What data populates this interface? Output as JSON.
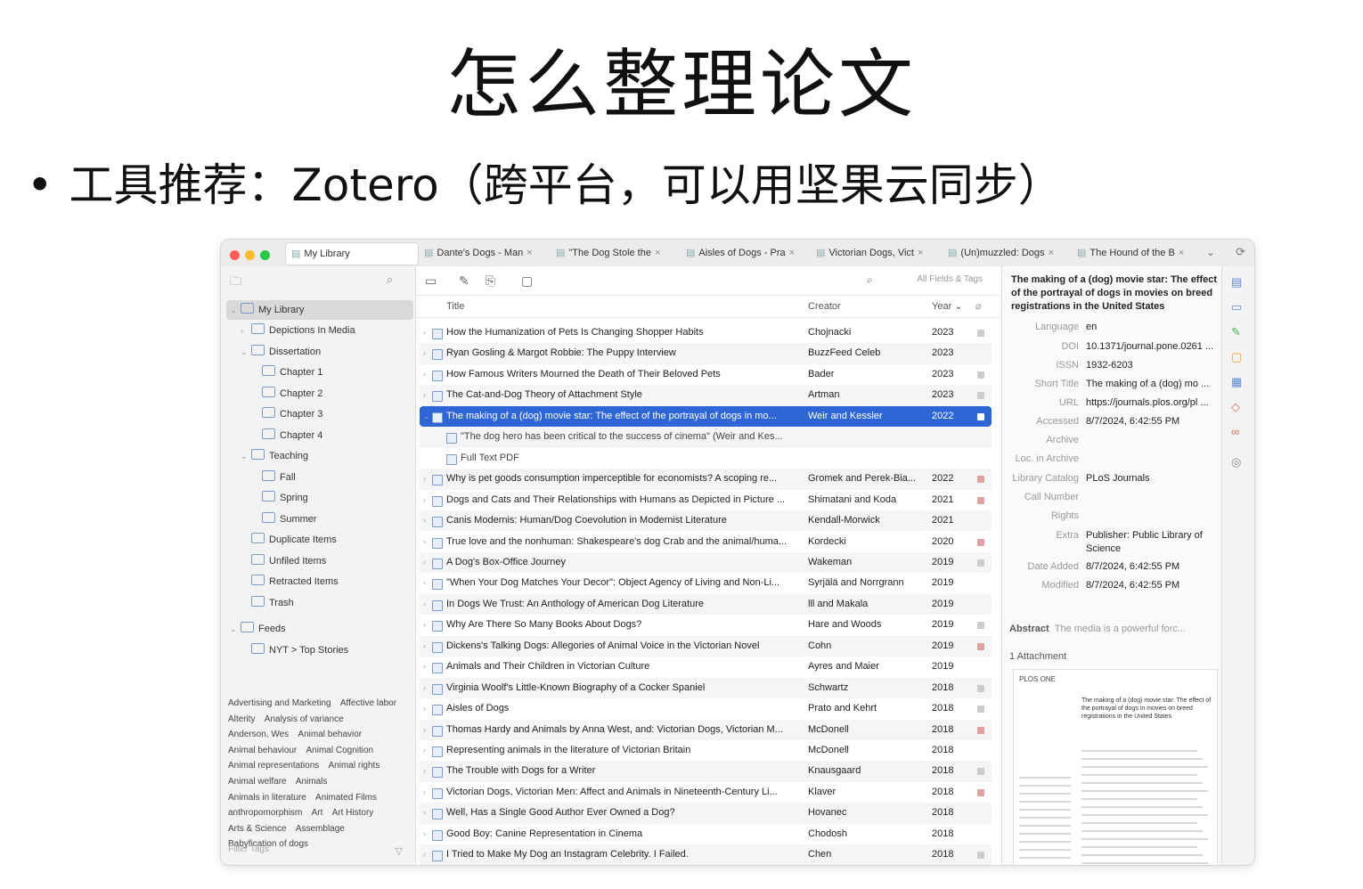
{
  "slide": {
    "title": "怎么整理论文",
    "bullet": "工具推荐：Zotero（跨平台，可以用坚果云同步）"
  },
  "tabs": [
    {
      "label": "My Library"
    },
    {
      "label": "Dante's Dogs - Man"
    },
    {
      "label": "\"The Dog Stole the"
    },
    {
      "label": "Aisles of Dogs - Pra"
    },
    {
      "label": "Victorian Dogs, Vict"
    },
    {
      "label": "(Un)muzzled: Dogs"
    },
    {
      "label": "The Hound of the B"
    }
  ],
  "collections": [
    {
      "label": "My Library",
      "level": 0,
      "twisty": "⌄"
    },
    {
      "label": "Depictions In Media",
      "level": 1,
      "twisty": "›"
    },
    {
      "label": "Dissertation",
      "level": 1,
      "twisty": "⌄"
    },
    {
      "label": "Chapter 1",
      "level": 2,
      "twisty": ""
    },
    {
      "label": "Chapter 2",
      "level": 2,
      "twisty": ""
    },
    {
      "label": "Chapter 3",
      "level": 2,
      "twisty": ""
    },
    {
      "label": "Chapter 4",
      "level": 2,
      "twisty": ""
    },
    {
      "label": "Teaching",
      "level": 1,
      "twisty": "⌄"
    },
    {
      "label": "Fall",
      "level": 2,
      "twisty": ""
    },
    {
      "label": "Spring",
      "level": 2,
      "twisty": ""
    },
    {
      "label": "Summer",
      "level": 2,
      "twisty": ""
    },
    {
      "label": "Duplicate Items",
      "level": 1,
      "twisty": ""
    },
    {
      "label": "Unfiled Items",
      "level": 1,
      "twisty": ""
    },
    {
      "label": "Retracted Items",
      "level": 1,
      "twisty": ""
    },
    {
      "label": "Trash",
      "level": 1,
      "twisty": ""
    },
    {
      "label": "Feeds",
      "level": 0,
      "twisty": "⌄"
    },
    {
      "label": "NYT > Top Stories",
      "level": 1,
      "twisty": ""
    }
  ],
  "tags": [
    "Advertising and Marketing",
    "Affective labor",
    "Alterity",
    "Analysis of variance",
    "Anderson, Wes",
    "Animal behavior",
    "Animal behaviour",
    "Animal Cognition",
    "Animal representations",
    "Animal rights",
    "Animal welfare",
    "Animals",
    "Animals in literature",
    "Animated Films",
    "anthropomorphism",
    "Art",
    "Art History",
    "Arts & Science",
    "Assemblage",
    "Babyfication of dogs"
  ],
  "filter_tags_placeholder": "Filter Tags",
  "search_placeholder": "All Fields & Tags",
  "columns": {
    "title": "Title",
    "creator": "Creator",
    "year": "Year ⌄"
  },
  "items": [
    {
      "title": "How the Humanization of Pets Is Changing Shopper Habits",
      "creator": "Chojnacki",
      "year": "2023",
      "att": "doc"
    },
    {
      "title": "Ryan Gosling & Margot Robbie: The Puppy Interview",
      "creator": "BuzzFeed Celeb",
      "year": "2023",
      "att": ""
    },
    {
      "title": "How Famous Writers Mourned the Death of Their Beloved Pets",
      "creator": "Bader",
      "year": "2023",
      "att": "doc"
    },
    {
      "title": "The Cat-and-Dog Theory of Attachment Style",
      "creator": "Artman",
      "year": "2023",
      "att": "doc"
    },
    {
      "title": "The making of a (dog) movie star: The effect of the portrayal of dogs in mo...",
      "creator": "Weir and Kessler",
      "year": "2022",
      "att": "doc",
      "selected": true
    },
    {
      "title": "\"The dog hero has been critical to the success of cinema\" (Weir and Kes...",
      "creator": "",
      "year": "",
      "att": "",
      "child": true
    },
    {
      "title": "Full Text PDF",
      "creator": "",
      "year": "",
      "att": "",
      "child": true
    },
    {
      "title": "Why is pet goods consumption imperceptible for economists? A scoping re...",
      "creator": "Gromek and Perek-Bia...",
      "year": "2022",
      "att": "pdf"
    },
    {
      "title": "Dogs and Cats and Their Relationships with Humans as Depicted in Picture ...",
      "creator": "Shimatani and Koda",
      "year": "2021",
      "att": "pdf"
    },
    {
      "title": "Canis Modernis: Human/Dog Coevolution in Modernist Literature",
      "creator": "Kendall-Morwick",
      "year": "2021",
      "att": ""
    },
    {
      "title": "True love and the nonhuman: Shakespeare's dog Crab and the animal/huma...",
      "creator": "Kordecki",
      "year": "2020",
      "att": "pdf"
    },
    {
      "title": "A Dog's Box-Office Journey",
      "creator": "Wakeman",
      "year": "2019",
      "att": "doc"
    },
    {
      "title": "\"When Your Dog Matches Your Decor\": Object Agency of Living and Non-Li...",
      "creator": "Syrjälä and Norrgrann",
      "year": "2019",
      "att": ""
    },
    {
      "title": "In Dogs We Trust: An Anthology of American Dog Literature",
      "creator": "lll and Makala",
      "year": "2019",
      "att": ""
    },
    {
      "title": "Why Are There So Many Books About Dogs?",
      "creator": "Hare and Woods",
      "year": "2019",
      "att": "doc"
    },
    {
      "title": "Dickens's Talking Dogs: Allegories of Animal Voice in the Victorian Novel",
      "creator": "Cohn",
      "year": "2019",
      "att": "pdf"
    },
    {
      "title": "Animals and Their Children in Victorian Culture",
      "creator": "Ayres and Maier",
      "year": "2019",
      "att": ""
    },
    {
      "title": "Virginia Woolf's Little-Known Biography of a Cocker Spaniel",
      "creator": "Schwartz",
      "year": "2018",
      "att": "doc"
    },
    {
      "title": "Aisles of Dogs",
      "creator": "Prato and Kehrt",
      "year": "2018",
      "att": "doc"
    },
    {
      "title": "Thomas Hardy and Animals by Anna West, and: Victorian Dogs, Victorian M...",
      "creator": "McDonell",
      "year": "2018",
      "att": "pdf"
    },
    {
      "title": "Representing animals in the literature of Victorian Britain",
      "creator": "McDonell",
      "year": "2018",
      "att": ""
    },
    {
      "title": "The Trouble with Dogs for a Writer",
      "creator": "Knausgaard",
      "year": "2018",
      "att": "doc"
    },
    {
      "title": "Victorian Dogs, Victorian Men: Affect and Animals in Nineteenth-Century Li...",
      "creator": "Klaver",
      "year": "2018",
      "att": "pdf"
    },
    {
      "title": "Well, Has a Single Good Author Ever Owned a Dog?",
      "creator": "Hovanec",
      "year": "2018",
      "att": ""
    },
    {
      "title": "Good Boy: Canine Representation in Cinema",
      "creator": "Chodosh",
      "year": "2018",
      "att": ""
    },
    {
      "title": "I Tried to Make My Dog an Instagram Celebrity. I Failed.",
      "creator": "Chen",
      "year": "2018",
      "att": "doc"
    }
  ],
  "detail": {
    "title": "The making of a (dog) movie star: The effect of the portrayal of dogs in movies on breed registrations in the United States",
    "fields": [
      {
        "key": "Language",
        "value": "en"
      },
      {
        "key": "DOI",
        "value": "10.1371/journal.pone.0261 ..."
      },
      {
        "key": "ISSN",
        "value": "1932-6203"
      },
      {
        "key": "Short Title",
        "value": "The making of a (dog) mo ..."
      },
      {
        "key": "URL",
        "value": "https://journals.plos.org/pl ..."
      },
      {
        "key": "Accessed",
        "value": "8/7/2024, 6:42:55 PM"
      },
      {
        "key": "Archive",
        "value": ""
      },
      {
        "key": "Loc. in Archive",
        "value": ""
      },
      {
        "key": "Library Catalog",
        "value": "PLoS Journals"
      },
      {
        "key": "Call Number",
        "value": ""
      },
      {
        "key": "Rights",
        "value": ""
      },
      {
        "key": "Extra",
        "value": "Publisher: Public Library of Science"
      },
      {
        "key": "Date Added",
        "value": "8/7/2024, 6:42:55 PM"
      },
      {
        "key": "Modified",
        "value": "8/7/2024, 6:42:55 PM"
      }
    ],
    "abstract_label": "Abstract",
    "abstract_preview": "The media is a powerful forc...",
    "attachments_label": "1 Attachment",
    "preview_brand": "PLOS ONE",
    "preview_title": "The making of a (dog) movie star: The effect of the portrayal of dogs in movies on breed registrations in the United States"
  },
  "colors": {
    "selection": "#2f66d6",
    "close": "#ff5f57",
    "minimize": "#febc2e",
    "zoom": "#28c840"
  }
}
